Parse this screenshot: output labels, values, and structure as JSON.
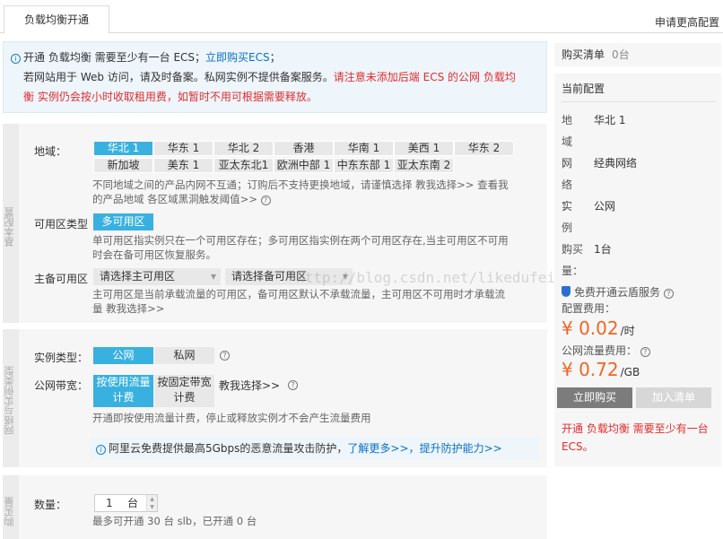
{
  "tab_active": "负载均衡开通",
  "top_link": "申请更高配置",
  "notice": {
    "line1_text": "开通 负载均衡 需要至少有一台 ECS；",
    "line1_link": "立即购买ECS",
    "line1_end": "；",
    "line2_text": "若网站用于 Web 访问，请及时备案。私网实例不提供备案服务。",
    "line2_warn_a": "请注意未添加后端 ECS 的公网 负载均",
    "line3_warn_b": "衡 实例仍会按小时收取租用费，如暂时不用可根据需要释放。"
  },
  "basic": {
    "side_label": "基本配置",
    "region_label": "地域：",
    "regions_row1": [
      "华北 1",
      "华东 1",
      "华北 2",
      "香港",
      "华南 1",
      "美西 1",
      "华东 2"
    ],
    "regions_row2": [
      "新加坡",
      "美东 1",
      "亚太东北1",
      "欧洲中部 1",
      "中东东部 1",
      "亚太东南 2"
    ],
    "region_hint_a": "不同地域之间的产品内网不互通；订购后不支持更换地域，请谨慎选择 教我选择>>  查看我",
    "region_hint_b": "的产品地域   各区域黑洞触发阈值>> ",
    "zone_type_label": "可用区类型",
    "zone_type_value": "多可用区",
    "zone_hint_a": "单可用区指实例只在一个可用区存在；多可用区指实例在两个可用区存在,当主可用区不可用",
    "zone_hint_b": "时会在备可用区恢复服务。",
    "master_label": "主备可用区",
    "master_select": "请选择主可用区",
    "slave_select": "请选择备可用区",
    "master_hint_a": "主可用区是当前承载流量的可用区，备可用区默认不承载流量，主可用区不可用时才承载流",
    "master_hint_b": "量 教我选择>>"
  },
  "network": {
    "side_label": "网络与实例类型",
    "instance_type_label": "实例类型：",
    "instance_public": "公网",
    "instance_private": "私网",
    "bandwidth_label": "公网带宽：",
    "bw_by_traffic_a": "按使用流量",
    "bw_by_traffic_b": "计费",
    "bw_fixed_a": "按固定带宽",
    "bw_fixed_b": "计费",
    "bw_help": "教我选择>>",
    "bw_hint": "开通即按使用流量计费，停止或释放实例才不会产生流量费用",
    "tip_text": "阿里云免费提供最高5Gbps的恶意流量攻击防护，",
    "tip_link1": "了解更多>>",
    "tip_sep": "，",
    "tip_link2": "提升防护能力>>"
  },
  "purchase": {
    "side_label": "购买量",
    "qty_label": "数量：",
    "qty_value": "1",
    "qty_unit": "台",
    "qty_hint": "最多可开通 30 台 slb，已开通 0 台"
  },
  "cart": {
    "title": "购买清单",
    "count": "0台"
  },
  "summary": {
    "title": "当前配置",
    "region_key": "地域：",
    "region_val": "华北 1",
    "network_key": "网络：",
    "network_val": "经典网络",
    "instance_key": "实例：",
    "instance_val": "公网",
    "qty_key": "购买量：",
    "qty_val": "1台",
    "shield_text": "免费开通云盾服务",
    "config_fee_label": "配置费用：",
    "config_fee": "¥ 0.02",
    "config_fee_unit": "/时",
    "traffic_fee_label": "公网流量费用：",
    "traffic_fee": "¥ 0.72",
    "traffic_fee_unit": "/GB",
    "buy_button": "立即购买",
    "cart_button": "加入清单",
    "warn": "开通 负载均衡 需要至少有一台 ECS。"
  },
  "watermark": "http://blog.csdn.net/likedufei",
  "colors": {
    "accent": "#39b1e0",
    "price": "#f26522",
    "warn": "#e02e2e",
    "link": "#0a72c8"
  }
}
